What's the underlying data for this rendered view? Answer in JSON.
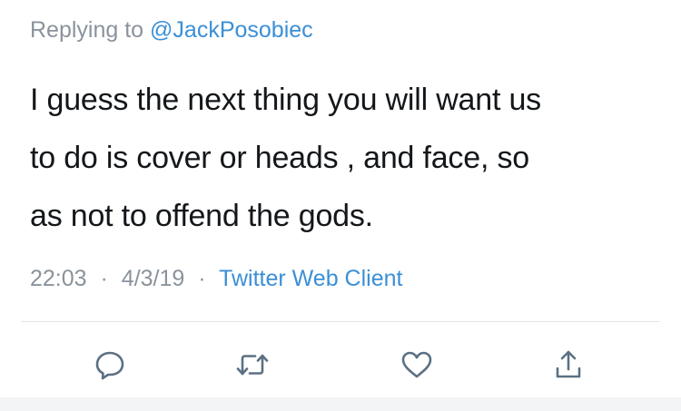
{
  "reply": {
    "prefix": "Replying to",
    "handle": "@JackPosobiec"
  },
  "tweet": {
    "lines": [
      "I guess the next thing you will want us",
      "to do is cover or heads , and face, so",
      "as not to offend the gods."
    ]
  },
  "meta": {
    "time": "22:03",
    "separator": "·",
    "date": "4/3/19",
    "client": "Twitter Web Client"
  },
  "actions": [
    {
      "name": "reply",
      "icon": "reply-bubble-icon"
    },
    {
      "name": "retweet",
      "icon": "retweet-icon"
    },
    {
      "name": "like",
      "icon": "heart-icon"
    },
    {
      "name": "share",
      "icon": "share-icon"
    }
  ],
  "colors": {
    "text": "#14171a",
    "muted": "#8a939c",
    "link": "#3b8fd6",
    "divider": "#e3e6e9"
  }
}
